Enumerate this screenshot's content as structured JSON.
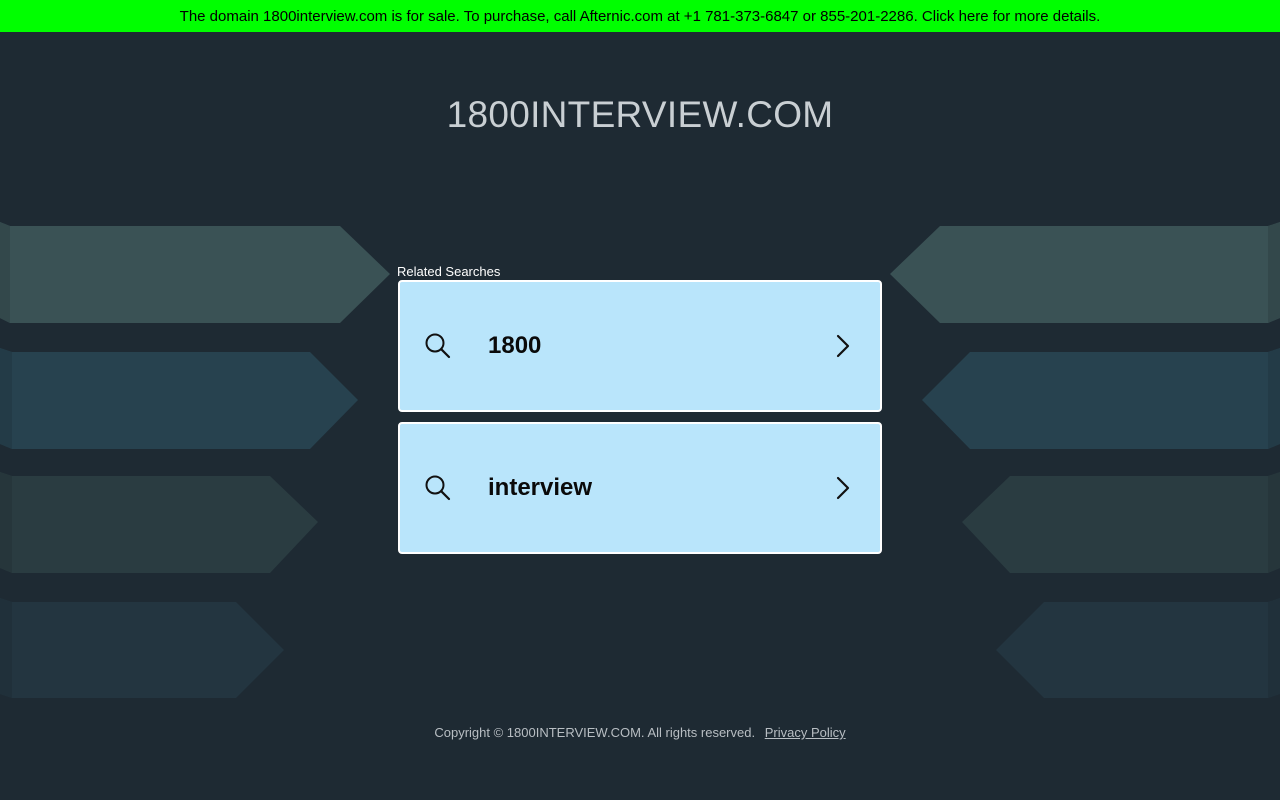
{
  "banner": {
    "text": "The domain 1800interview.com is for sale. To purchase, call Afternic.com at +1 781-373-6847 or 855-201-2286. Click here for more details."
  },
  "header": {
    "title": "1800INTERVIEW.COM"
  },
  "related": {
    "label": "Related Searches",
    "items": [
      {
        "label": "1800",
        "icon": "search-icon",
        "arrow": "chevron-right-icon"
      },
      {
        "label": "interview",
        "icon": "search-icon",
        "arrow": "chevron-right-icon"
      }
    ]
  },
  "footer": {
    "copyright": "Copyright © 1800INTERVIEW.COM.",
    "rights": "All rights reserved.",
    "privacy_label": "Privacy Policy"
  },
  "colors": {
    "background": "#1e2a33",
    "banner": "#00ff00",
    "card": "#b9e5fb",
    "card_border": "#ffffff",
    "title_text": "#c9cfd3"
  }
}
